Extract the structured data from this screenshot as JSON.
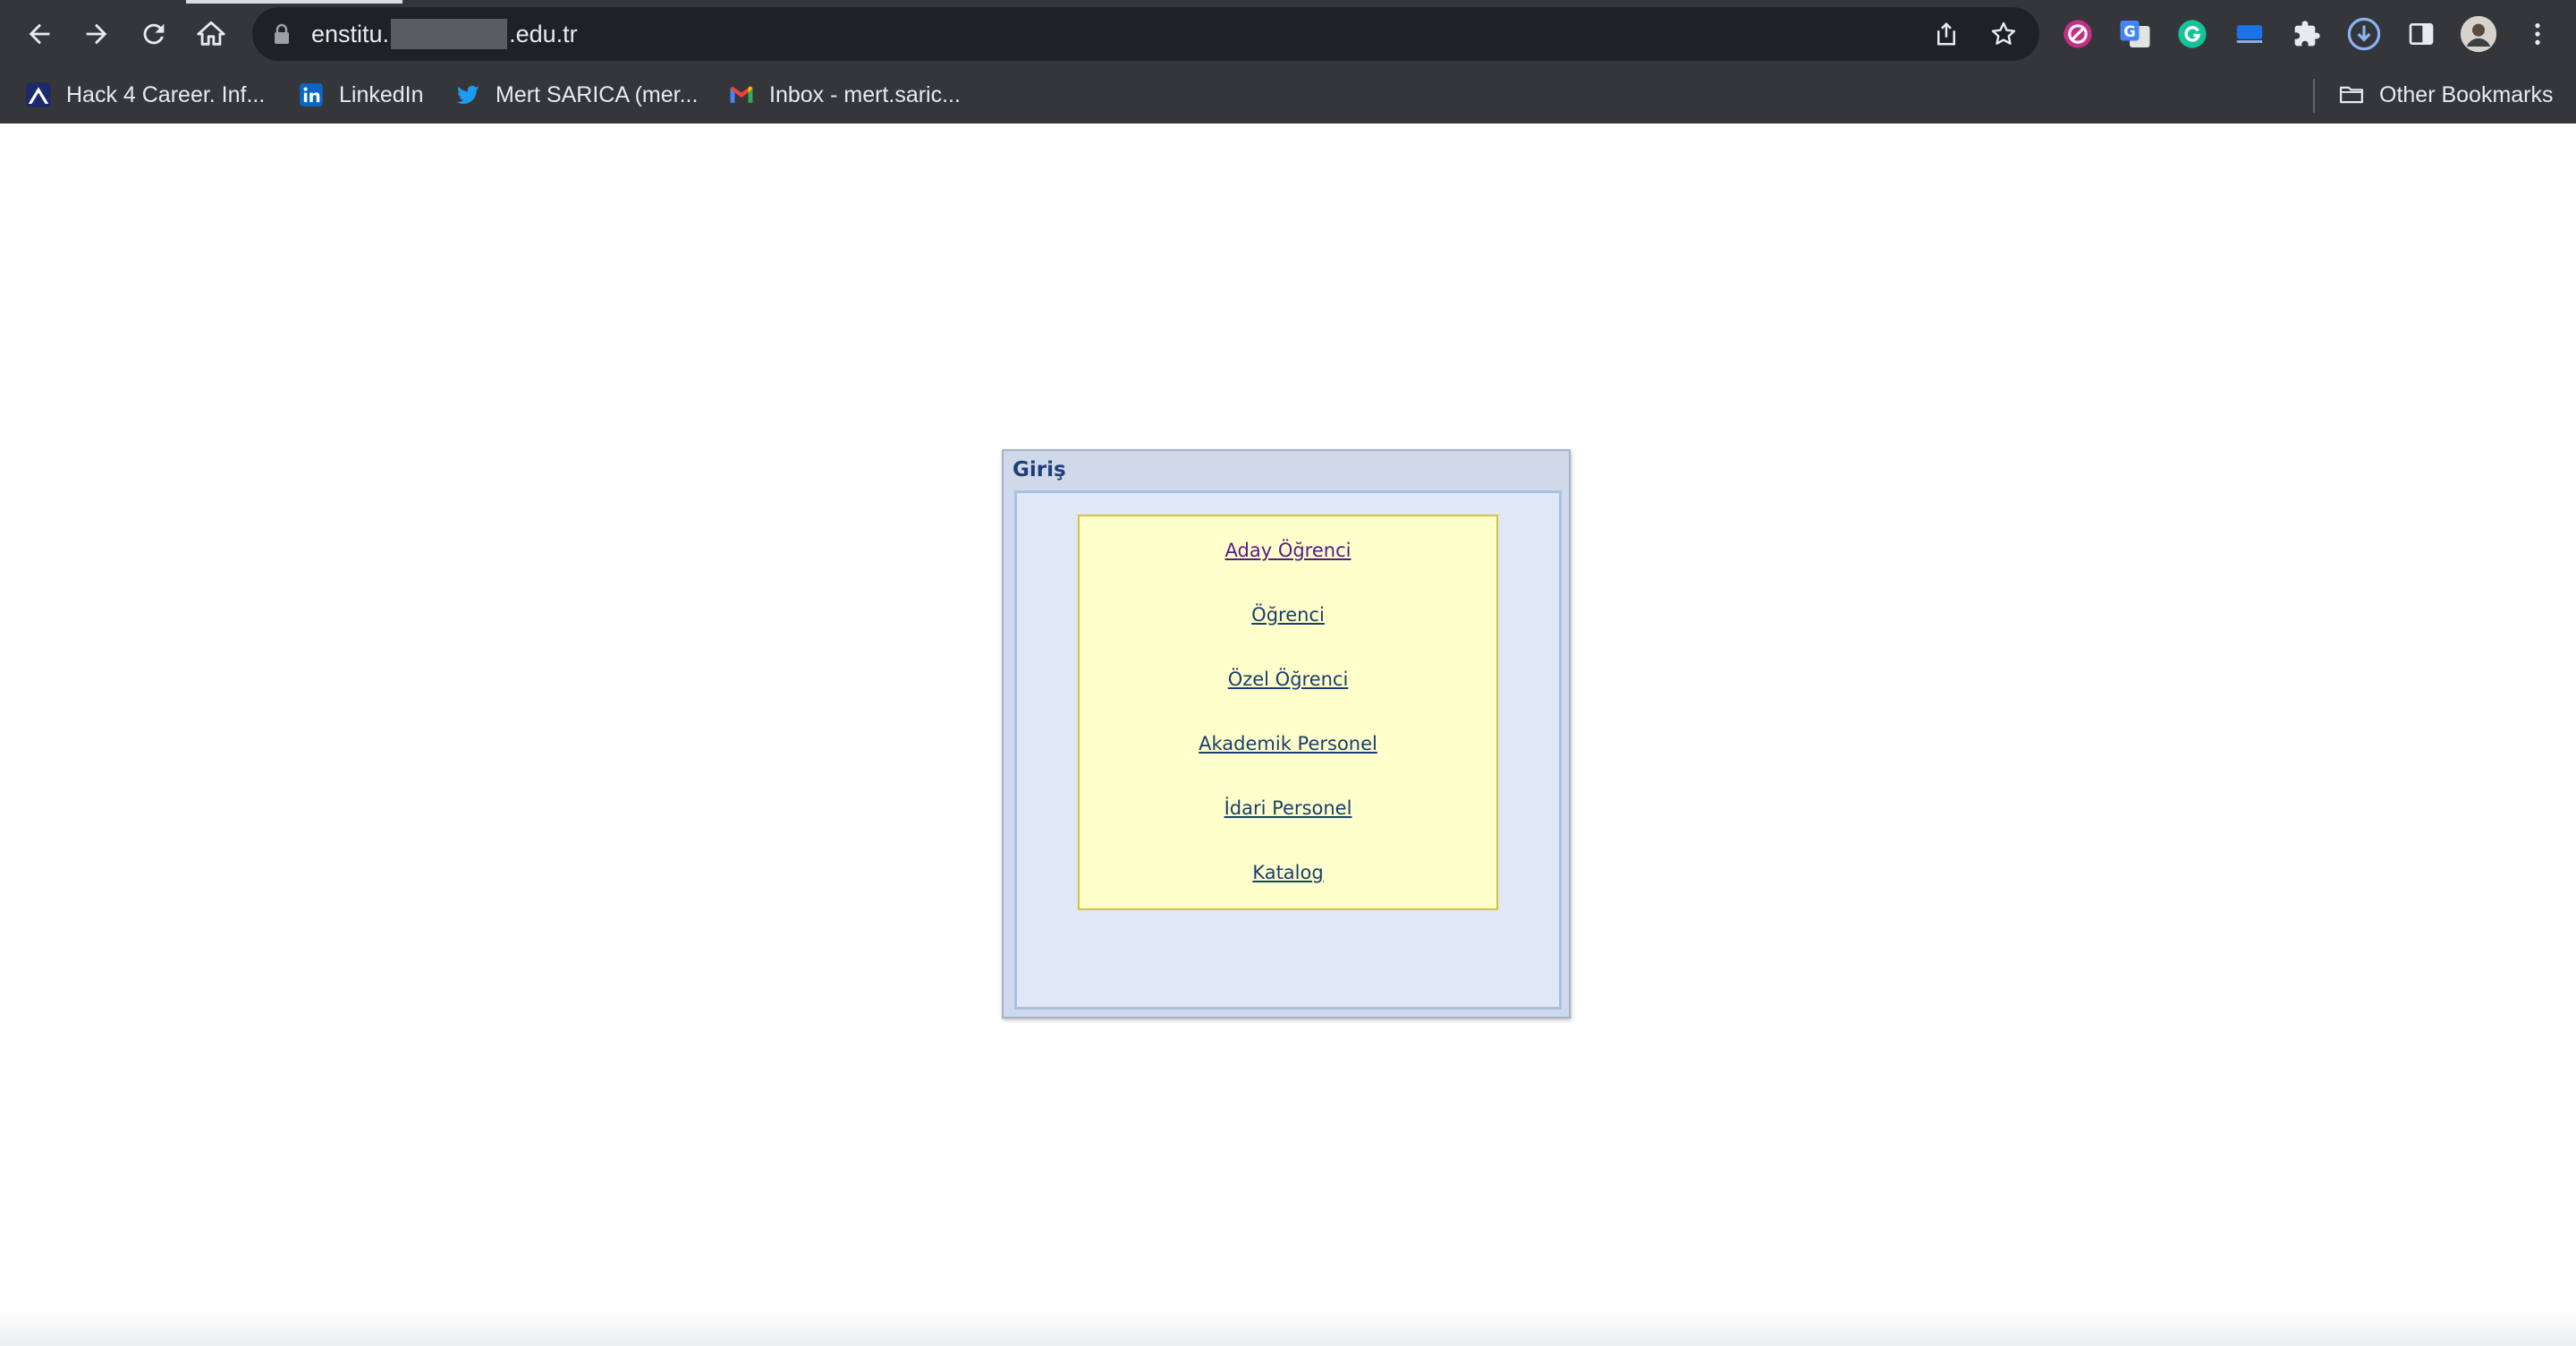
{
  "browser": {
    "url_prefix": "enstitu.",
    "url_suffix": ".edu.tr",
    "bookmarks": [
      {
        "label": "Hack 4 Career. Inf...",
        "icon": "hack4career-icon"
      },
      {
        "label": "LinkedIn",
        "icon": "linkedin-icon"
      },
      {
        "label": "Mert SARICA (mer...",
        "icon": "twitter-icon"
      },
      {
        "label": "Inbox - mert.saric...",
        "icon": "gmail-icon"
      }
    ],
    "other_bookmarks": "Other Bookmarks",
    "extensions": [
      "block-extension-icon",
      "google-translate-icon",
      "grammarly-icon",
      "blue-extension-icon",
      "puzzle-icon",
      "download-icon",
      "side-panel-icon",
      "profile-avatar",
      "more-menu-icon"
    ]
  },
  "login_panel": {
    "title": "Giriş",
    "links": [
      {
        "label": "Aday Öğrenci",
        "visited": true
      },
      {
        "label": "Öğrenci",
        "visited": false
      },
      {
        "label": "Özel Öğrenci",
        "visited": false
      },
      {
        "label": "Akademik Personel",
        "visited": false
      },
      {
        "label": "İdari Personel",
        "visited": false
      },
      {
        "label": "Katalog",
        "visited": false
      }
    ]
  },
  "colors": {
    "chrome_bg": "#35363a",
    "panel_bg": "#cfd9e9",
    "menu_bg": "#ffffcc",
    "link": "#1a3e6c",
    "visited_link": "#551a8b"
  }
}
